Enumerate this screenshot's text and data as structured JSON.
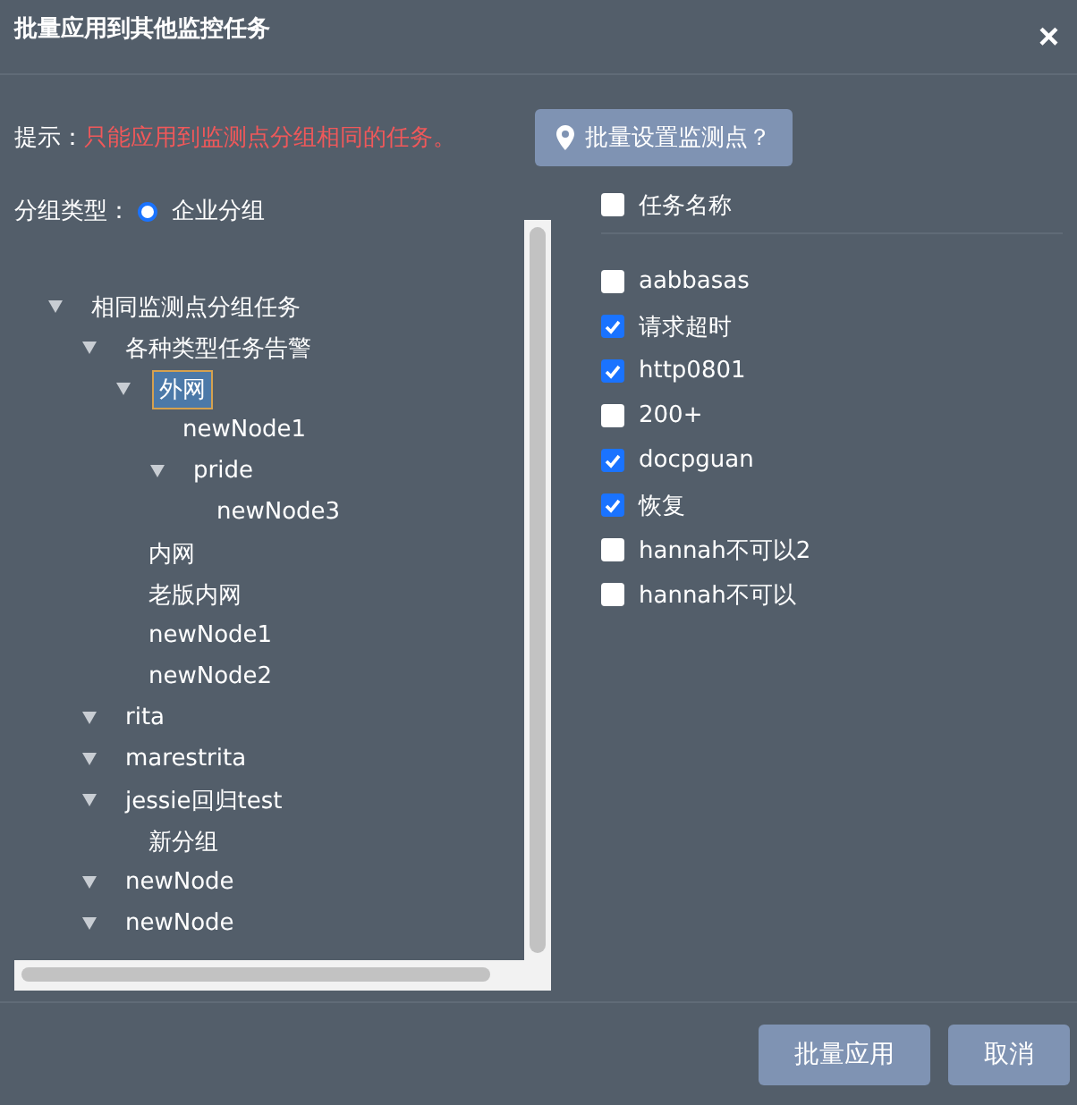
{
  "window": {
    "title": "批量应用到其他监控任务",
    "close": "×"
  },
  "hint": {
    "label": "提示：",
    "message": "只能应用到监测点分组相同的任务。"
  },
  "location_button": {
    "label": "批量设置监测点？"
  },
  "group_type": {
    "label": "分组类型：",
    "options": [
      {
        "label": "企业分组",
        "selected": true
      }
    ]
  },
  "tree": [
    {
      "label": "相同监测点分组任务",
      "kind": "group",
      "expanded": true,
      "selected": false,
      "children": [
        {
          "label": "各种类型任务告警",
          "kind": "group",
          "expanded": true,
          "selected": false,
          "children": [
            {
              "label": "外网",
              "kind": "group",
              "expanded": true,
              "selected": true,
              "children": [
                {
                  "label": "newNode1",
                  "kind": "leaf",
                  "selected": false
                },
                {
                  "label": "pride",
                  "kind": "group",
                  "expanded": true,
                  "selected": false,
                  "children": [
                    {
                      "label": "newNode3",
                      "kind": "leaf",
                      "selected": false
                    }
                  ]
                }
              ]
            },
            {
              "label": "内网",
              "kind": "leaf",
              "selected": false
            },
            {
              "label": "老版内网",
              "kind": "leaf",
              "selected": false
            },
            {
              "label": "newNode1",
              "kind": "leaf",
              "selected": false
            },
            {
              "label": "newNode2",
              "kind": "leaf",
              "selected": false
            }
          ]
        },
        {
          "label": "rita",
          "kind": "group",
          "expanded": true,
          "selected": false
        },
        {
          "label": "marestrita",
          "kind": "group",
          "expanded": true,
          "selected": false
        },
        {
          "label": "jessie回归test",
          "kind": "group",
          "expanded": true,
          "selected": false,
          "children": [
            {
              "label": "新分组",
              "kind": "leaf",
              "selected": false
            }
          ]
        },
        {
          "label": "newNode",
          "kind": "group",
          "expanded": true,
          "selected": false
        },
        {
          "label": "newNode",
          "kind": "group",
          "expanded": true,
          "selected": false
        }
      ]
    }
  ],
  "tasks": {
    "header": {
      "label": "任务名称",
      "checked": false
    },
    "items": [
      {
        "label": "aabbasas",
        "checked": false
      },
      {
        "label": "请求超时",
        "checked": true
      },
      {
        "label": "http0801",
        "checked": true
      },
      {
        "label": "200+",
        "checked": false
      },
      {
        "label": "docpguan",
        "checked": true
      },
      {
        "label": "恢复",
        "checked": true
      },
      {
        "label": "hannah不可以2",
        "checked": false
      },
      {
        "label": "hannah不可以",
        "checked": false
      }
    ]
  },
  "buttons": [
    {
      "label": "批量应用"
    },
    {
      "label": "取消"
    }
  ]
}
